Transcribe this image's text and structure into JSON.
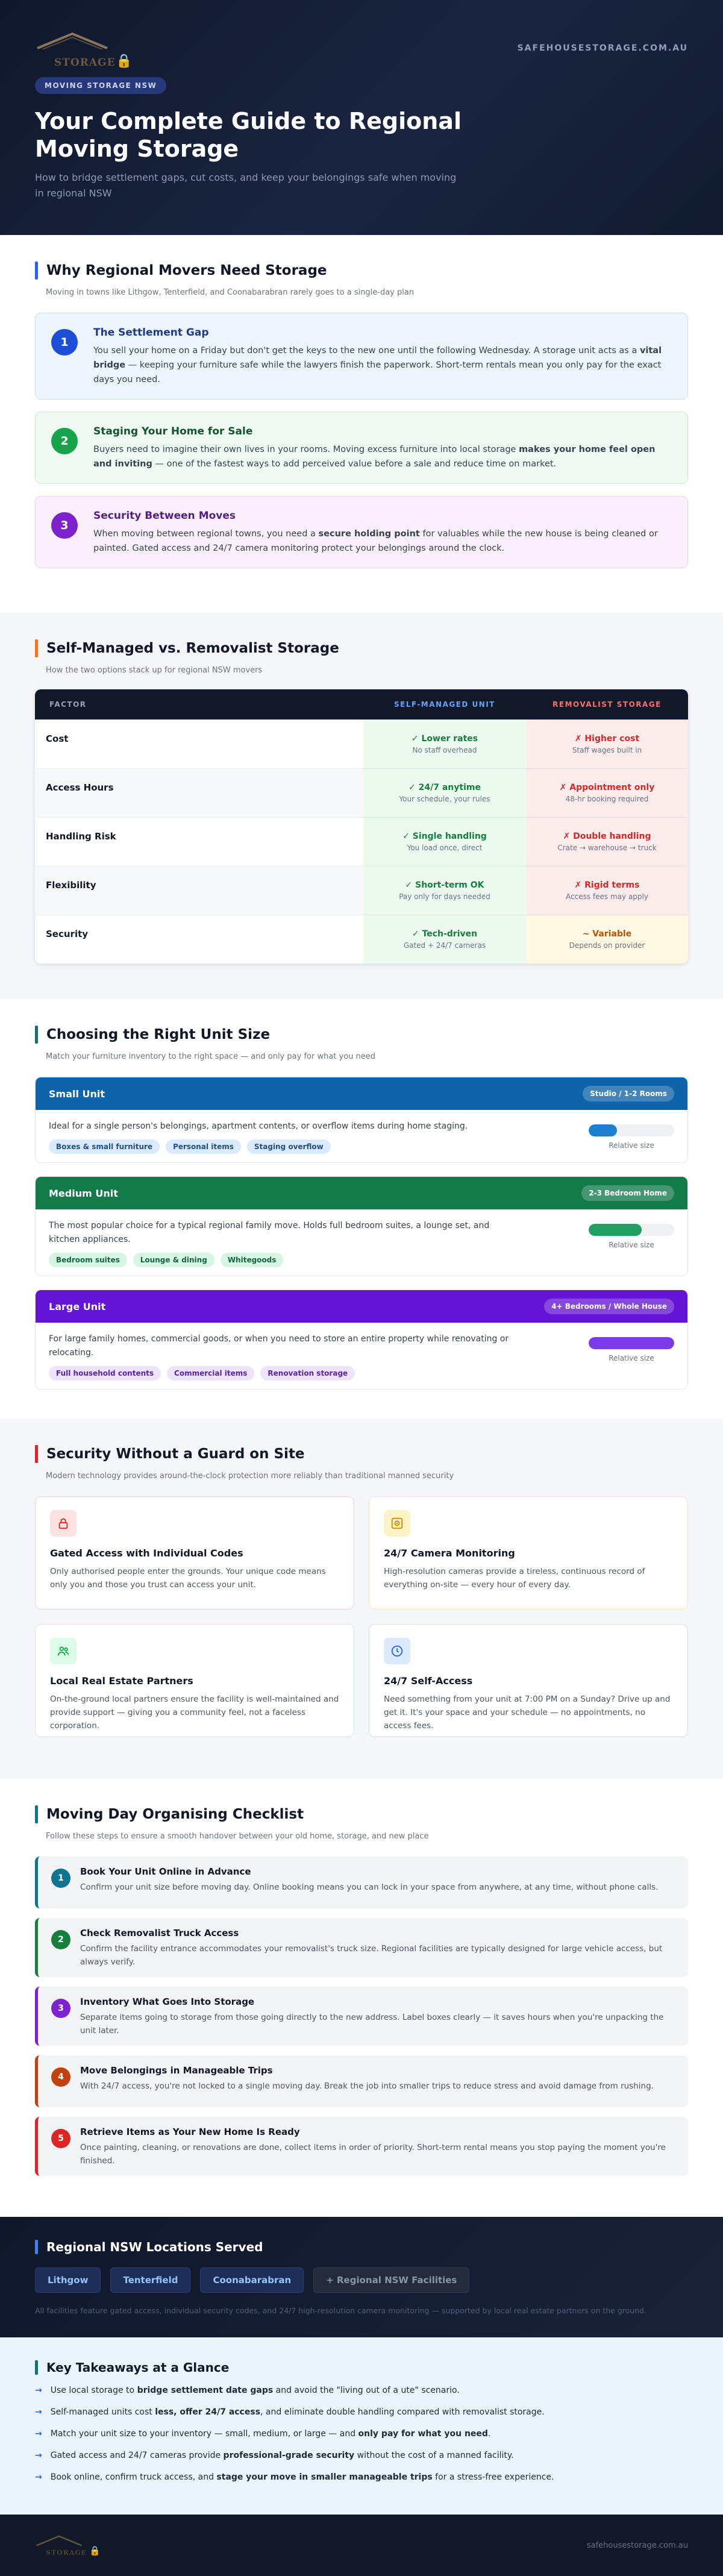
{
  "brand": {
    "logo_word": "STORAGE",
    "url": "SAFEHOUSESTORAGE.COM.AU"
  },
  "hero": {
    "badge": "MOVING STORAGE NSW",
    "title": "Your Complete Guide to Regional Moving Storage",
    "subtitle": "How to bridge settlement gaps, cut costs, and keep your belongings safe when moving in regional NSW"
  },
  "why": {
    "title": "Why Regional Movers Need Storage",
    "subtitle": "Moving in towns like Lithgow, Tenterfield, and Coonabarabran rarely goes to a single-day plan",
    "cards": [
      {
        "num": "1",
        "title": "The Settlement Gap",
        "body_a": "You sell your home on a Friday but don't get the keys to the new one until the following Wednesday. A storage unit acts as a ",
        "bold": "vital bridge",
        "body_b": " — keeping your furniture safe while the lawyers finish the paperwork. Short-term rentals mean you only pay for the exact days you need."
      },
      {
        "num": "2",
        "title": "Staging Your Home for Sale",
        "body_a": "Buyers need to imagine their own lives in your rooms. Moving excess furniture into local storage ",
        "bold": "makes your home feel open and inviting",
        "body_b": " — one of the fastest ways to add perceived value before a sale and reduce time on market."
      },
      {
        "num": "3",
        "title": "Security Between Moves",
        "body_a": "When moving between regional towns, you need a ",
        "bold": "secure holding point",
        "body_b": " for valuables while the new house is being cleaned or painted. Gated access and 24/7 camera monitoring protect your belongings around the clock."
      }
    ]
  },
  "compare": {
    "title": "Self-Managed vs. Removalist Storage",
    "subtitle": "How the two options stack up for regional NSW movers",
    "headers": {
      "factor": "FACTOR",
      "self": "SELF-MANAGED UNIT",
      "rem": "REMOVALIST STORAGE"
    },
    "rows": [
      {
        "factor": "Cost",
        "self": "✓ Lower rates",
        "self_sub": "No staff overhead",
        "rem": "✗ Higher cost",
        "rem_sub": "Staff wages built in"
      },
      {
        "factor": "Access Hours",
        "self": "✓ 24/7 anytime",
        "self_sub": "Your schedule, your rules",
        "rem": "✗ Appointment only",
        "rem_sub": "48-hr booking required"
      },
      {
        "factor": "Handling Risk",
        "self": "✓ Single handling",
        "self_sub": "You load once, direct",
        "rem": "✗ Double handling",
        "rem_sub": "Crate → warehouse → truck"
      },
      {
        "factor": "Flexibility",
        "self": "✓ Short-term OK",
        "self_sub": "Pay only for days needed",
        "rem": "✗ Rigid terms",
        "rem_sub": "Access fees may apply"
      },
      {
        "factor": "Security",
        "self": "✓ Tech-driven",
        "self_sub": "Gated + 24/7 cameras",
        "rem": "~ Variable",
        "rem_sub": "Depends on provider"
      }
    ]
  },
  "units": {
    "title": "Choosing the Right Unit Size",
    "subtitle": "Match your furniture inventory to the right space — and only pay for what you need",
    "bar_label": "Relative size",
    "items": [
      {
        "name": "Small Unit",
        "size": "Studio / 1-2 Rooms",
        "desc": "Ideal for a single person's belongings, apartment contents, or overflow items during home staging.",
        "tags": [
          "Boxes & small furniture",
          "Personal items",
          "Staging overflow"
        ],
        "fill": 0.33,
        "color": "#0f63a8",
        "tag_bg": "#dbeafe",
        "tag_fg": "#1e4f8f",
        "bar": "#1d7fd0"
      },
      {
        "name": "Medium Unit",
        "size": "2-3 Bedroom Home",
        "desc": "The most popular choice for a typical regional family move. Holds full bedroom suites, a lounge set, and kitchen appliances.",
        "tags": [
          "Bedroom suites",
          "Lounge & dining",
          "Whitegoods"
        ],
        "fill": 0.62,
        "color": "#137a4a",
        "tag_bg": "#d6f5e3",
        "tag_fg": "#15663f",
        "bar": "#22a064"
      },
      {
        "name": "Large Unit",
        "size": "4+ Bedrooms / Whole House",
        "desc": "For large family homes, commercial goods, or when you need to store an entire property while renovating or relocating.",
        "tags": [
          "Full household contents",
          "Commercial items",
          "Renovation storage"
        ],
        "fill": 1.0,
        "color": "#6414d4",
        "tag_bg": "#ede4fd",
        "tag_fg": "#5b21b6",
        "bar": "#7c3aed"
      }
    ]
  },
  "security": {
    "title": "Security Without a Guard on Site",
    "subtitle": "Modern technology provides around-the-clock protection more reliably than traditional manned security",
    "cards": [
      {
        "icon": "lock-icon",
        "title": "Gated Access with Individual Codes",
        "body": "Only authorised people enter the grounds. Your unique code means only you and those you trust can access your unit."
      },
      {
        "icon": "camera-icon",
        "title": "24/7 Camera Monitoring",
        "body": "High-resolution cameras provide a tireless, continuous record of everything on-site — every hour of every day."
      },
      {
        "icon": "people-icon",
        "title": "Local Real Estate Partners",
        "body": "On-the-ground local partners ensure the facility is well-maintained and provide support — giving you a community feel, not a faceless corporation."
      },
      {
        "icon": "clock-icon",
        "title": "24/7 Self-Access",
        "body": "Need something from your unit at 7:00 PM on a Sunday? Drive up and get it. It's your space and your schedule — no appointments, no access fees."
      }
    ]
  },
  "checklist": {
    "title": "Moving Day Organising Checklist",
    "subtitle": "Follow these steps to ensure a smooth handover between your old home, storage, and new place",
    "steps": [
      {
        "num": "1",
        "title": "Book Your Unit Online in Advance",
        "body": "Confirm your unit size before moving day. Online booking means you can lock in your space from anywhere, at any time, without phone calls."
      },
      {
        "num": "2",
        "title": "Check Removalist Truck Access",
        "body": "Confirm the facility entrance accommodates your removalist's truck size. Regional facilities are typically designed for large vehicle access, but always verify."
      },
      {
        "num": "3",
        "title": "Inventory What Goes Into Storage",
        "body": "Separate items going to storage from those going directly to the new address. Label boxes clearly — it saves hours when you're unpacking the unit later."
      },
      {
        "num": "4",
        "title": "Move Belongings in Manageable Trips",
        "body": "With 24/7 access, you're not locked to a single moving day. Break the job into smaller trips to reduce stress and avoid damage from rushing."
      },
      {
        "num": "5",
        "title": "Retrieve Items as Your New Home Is Ready",
        "body": "Once painting, cleaning, or renovations are done, collect items in order of priority. Short-term rental means you stop paying the moment you're finished."
      }
    ]
  },
  "locations": {
    "title": "Regional NSW Locations Served",
    "items": [
      "Lithgow",
      "Tenterfield",
      "Coonabarabran",
      "+ Regional NSW Facilities"
    ],
    "note": "All facilities feature gated access, individual security codes, and 24/7 high-resolution camera monitoring — supported by local real estate partners on the ground."
  },
  "takeaways": {
    "title": "Key Takeaways at a Glance",
    "items": [
      {
        "a": "Use local storage to ",
        "b": "bridge settlement date gaps",
        "c": " and avoid the \"living out of a ute\" scenario."
      },
      {
        "a": "Self-managed units cost ",
        "b": "less, offer 24/7 access",
        "c": ", and eliminate double handling compared with removalist storage."
      },
      {
        "a": "Match your unit size to your inventory — small, medium, or large — and ",
        "b": "only pay for what you need",
        "c": "."
      },
      {
        "a": "Gated access and 24/7 cameras provide ",
        "b": "professional-grade security",
        "c": " without the cost of a manned facility."
      },
      {
        "a": "Book online, confirm truck access, and ",
        "b": "stage your move in smaller manageable trips",
        "c": " for a stress-free experience."
      }
    ]
  },
  "footer": {
    "url": "safehousestorage.com.au"
  },
  "colors": {
    "accent_blue": "#2563eb",
    "accent_orange": "#f97316",
    "accent_teal": "#0f766e",
    "accent_red": "#dc2626",
    "dark": "#111827"
  }
}
